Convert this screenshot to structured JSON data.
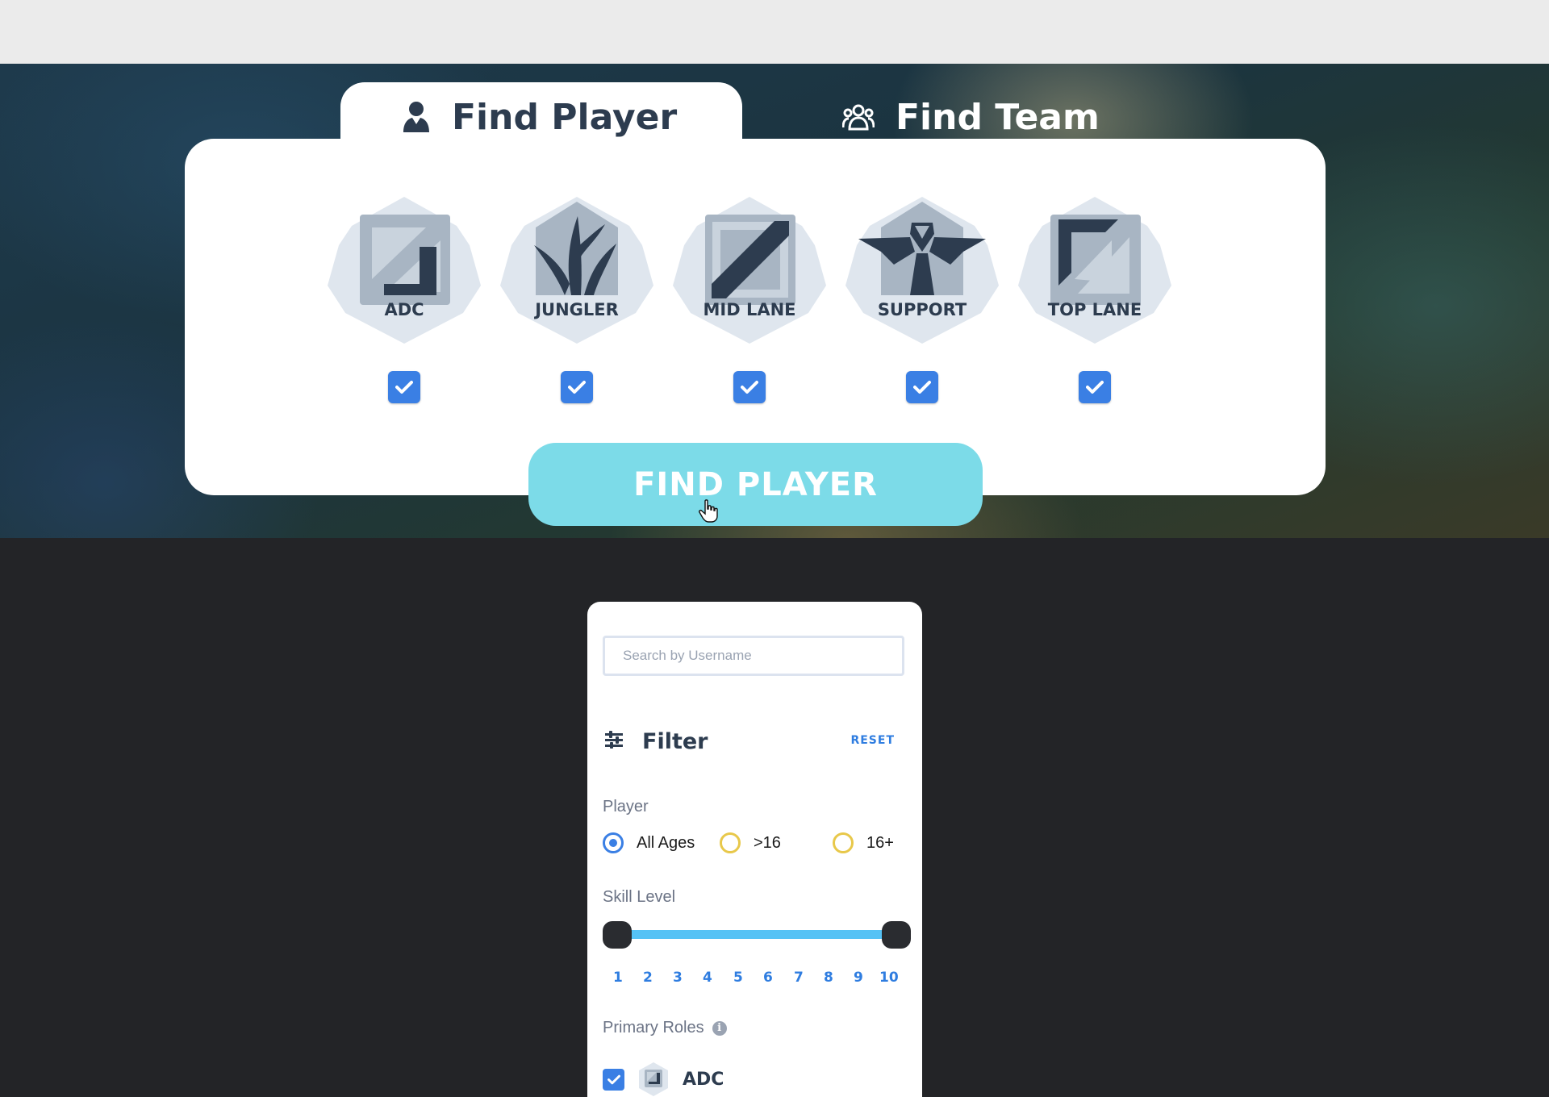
{
  "tabs": [
    {
      "label": "Find Player",
      "icon": "user-icon",
      "active": true
    },
    {
      "label": "Find Team",
      "icon": "team-icon",
      "active": false
    }
  ],
  "roles": [
    {
      "label": "ADC",
      "icon": "adc-role-icon",
      "checked": true
    },
    {
      "label": "JUNGLER",
      "icon": "jungler-role-icon",
      "checked": true
    },
    {
      "label": "MID LANE",
      "icon": "mid-lane-role-icon",
      "checked": true
    },
    {
      "label": "SUPPORT",
      "icon": "support-role-icon",
      "checked": true
    },
    {
      "label": "TOP LANE",
      "icon": "top-lane-role-icon",
      "checked": true
    }
  ],
  "find_button": "FIND PLAYER",
  "search": {
    "placeholder": "Search by Username",
    "value": ""
  },
  "filter": {
    "title": "Filter",
    "reset": "RESET",
    "player": {
      "label": "Player",
      "options": [
        "All Ages",
        ">16",
        "16+"
      ],
      "selected": "All Ages"
    },
    "skill": {
      "label": "Skill Level",
      "ticks": [
        "1",
        "2",
        "3",
        "4",
        "5",
        "6",
        "7",
        "8",
        "9",
        "10"
      ],
      "range": [
        1,
        10
      ]
    },
    "primary_roles": {
      "label": "Primary Roles",
      "items": [
        {
          "label": "ADC",
          "checked": true
        }
      ]
    }
  },
  "colors": {
    "accent": "#3a7fe4",
    "button": "#7cdbe8",
    "slider": "#55c2f5",
    "radio_off": "#e8c84a",
    "text_dark": "#2d3c4f"
  }
}
